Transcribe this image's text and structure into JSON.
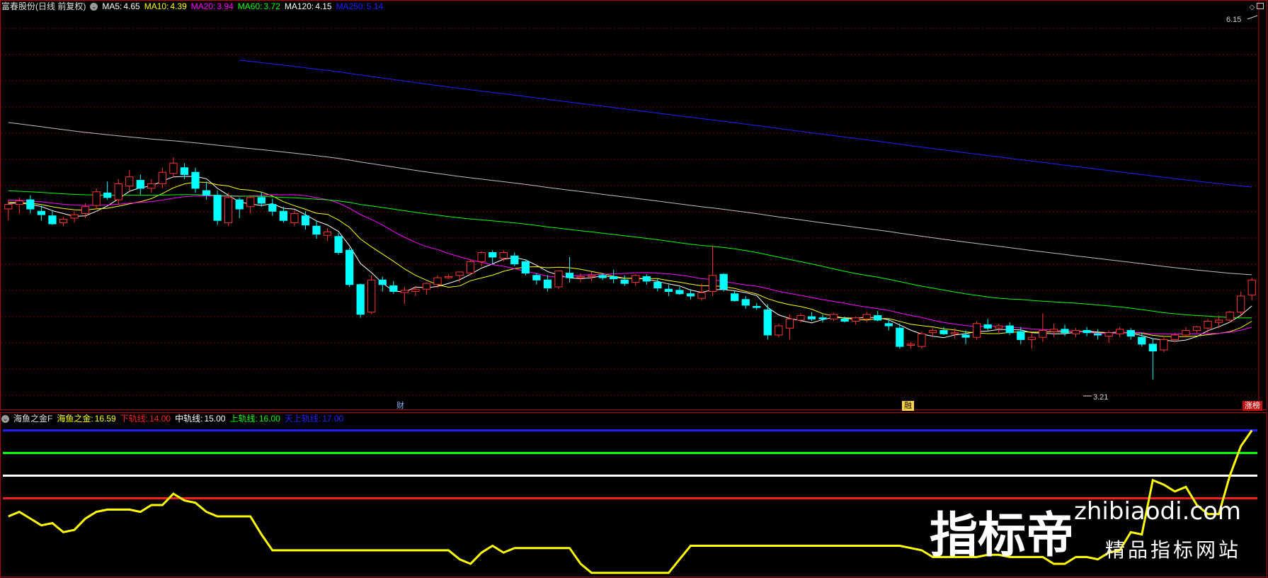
{
  "header": {
    "title": "富春股份(日线 前复权)",
    "ma": [
      {
        "label": "MA5:",
        "value": "4.65",
        "color": "#ffffff"
      },
      {
        "label": "MA10:",
        "value": "4.39",
        "color": "#ffff00"
      },
      {
        "label": "MA20:",
        "value": "3.94",
        "color": "#ff00ff"
      },
      {
        "label": "MA60:",
        "value": "3.72",
        "color": "#00ff00"
      },
      {
        "label": "MA120:",
        "value": "4.15",
        "color": "#ffffff"
      },
      {
        "label": "MA250:",
        "value": "5.14",
        "color": "#2020ff"
      }
    ]
  },
  "indicator": {
    "name": "海鱼之金F",
    "lines": [
      {
        "label": "海鱼之金:",
        "value": "16.59",
        "color": "#ffff00"
      },
      {
        "label": "下轨线:",
        "value": "14.00",
        "color": "#ff2020"
      },
      {
        "label": "中轨线:",
        "value": "15.00",
        "color": "#ffffff"
      },
      {
        "label": "上轨线:",
        "value": "16.00",
        "color": "#00ff00"
      },
      {
        "label": "天上轨线:",
        "value": "17.00",
        "color": "#2020ff"
      }
    ]
  },
  "markers": {
    "high_label": "6.15",
    "low_label": "3.21",
    "badge_cai": "财",
    "badge_rong": "融",
    "badge_zhangting": "涨榜"
  },
  "watermark": {
    "brand": "指标帝",
    "url": "zhibiaodi.com",
    "tagline": "精品指标网站"
  },
  "colors": {
    "up": "#ff3232",
    "down": "#00ffff",
    "border": "#b00000",
    "grid": "#7a0000"
  },
  "chart_data": [
    {
      "type": "candlestick",
      "title": "富春股份(日线 前复权)",
      "ylim": [
        3.0,
        6.4
      ],
      "x": [
        0,
        1,
        2,
        3,
        4,
        5,
        6,
        7,
        8,
        9,
        10,
        11,
        12,
        13,
        14,
        15,
        16,
        17,
        18,
        19,
        20,
        21,
        22,
        23,
        24,
        25,
        26,
        27,
        28,
        29,
        30,
        31,
        32,
        33,
        34,
        35,
        36,
        37,
        38,
        39,
        40,
        41,
        42,
        43,
        44,
        45,
        46,
        47,
        48,
        49,
        50,
        51,
        52,
        53,
        54,
        55,
        56,
        57,
        58,
        59,
        60,
        61,
        62,
        63,
        64,
        65,
        66,
        67,
        68,
        69,
        70,
        71,
        72,
        73,
        74,
        75,
        76,
        77,
        78,
        79,
        80,
        81,
        82,
        83,
        84,
        85,
        86,
        87,
        88,
        89,
        90,
        91,
        92,
        93,
        94,
        95,
        96,
        97,
        98,
        99,
        100,
        101,
        102,
        103,
        104,
        105,
        106,
        107,
        108,
        109,
        110,
        111,
        112,
        113
      ],
      "ohlc": [
        [
          4.7,
          4.78,
          4.6,
          4.74
        ],
        [
          4.74,
          4.8,
          4.66,
          4.77
        ],
        [
          4.78,
          4.82,
          4.66,
          4.7
        ],
        [
          4.68,
          4.73,
          4.6,
          4.65
        ],
        [
          4.64,
          4.69,
          4.56,
          4.57
        ],
        [
          4.58,
          4.63,
          4.55,
          4.61
        ],
        [
          4.62,
          4.68,
          4.58,
          4.65
        ],
        [
          4.66,
          4.75,
          4.62,
          4.72
        ],
        [
          4.73,
          4.88,
          4.7,
          4.85
        ],
        [
          4.84,
          4.94,
          4.78,
          4.8
        ],
        [
          4.78,
          4.96,
          4.74,
          4.92
        ],
        [
          4.9,
          5.04,
          4.86,
          4.98
        ],
        [
          4.95,
          5.0,
          4.82,
          4.88
        ],
        [
          4.88,
          4.96,
          4.84,
          4.92
        ],
        [
          4.92,
          5.06,
          4.88,
          5.02
        ],
        [
          5.01,
          5.15,
          4.98,
          5.1
        ],
        [
          5.06,
          5.1,
          4.96,
          5.0
        ],
        [
          5.02,
          5.06,
          4.84,
          4.88
        ],
        [
          4.86,
          4.94,
          4.78,
          4.82
        ],
        [
          4.82,
          4.86,
          4.56,
          4.6
        ],
        [
          4.58,
          4.84,
          4.55,
          4.8
        ],
        [
          4.78,
          4.8,
          4.62,
          4.7
        ],
        [
          4.72,
          4.82,
          4.66,
          4.8
        ],
        [
          4.8,
          4.85,
          4.72,
          4.75
        ],
        [
          4.74,
          4.79,
          4.64,
          4.68
        ],
        [
          4.68,
          4.72,
          4.58,
          4.6
        ],
        [
          4.58,
          4.69,
          4.55,
          4.66
        ],
        [
          4.64,
          4.68,
          4.52,
          4.56
        ],
        [
          4.55,
          4.6,
          4.44,
          4.48
        ],
        [
          4.47,
          4.53,
          4.42,
          4.5
        ],
        [
          4.46,
          4.49,
          4.3,
          4.32
        ],
        [
          4.34,
          4.36,
          4.02,
          4.04
        ],
        [
          4.04,
          4.05,
          3.75,
          3.78
        ],
        [
          3.8,
          4.12,
          3.78,
          4.08
        ],
        [
          4.08,
          4.11,
          3.98,
          4.04
        ],
        [
          4.03,
          4.07,
          3.96,
          3.98
        ],
        [
          3.97,
          4.02,
          3.87,
          3.99
        ],
        [
          3.98,
          4.03,
          3.94,
          4.0
        ],
        [
          4.0,
          4.06,
          3.95,
          4.05
        ],
        [
          4.04,
          4.12,
          4.01,
          4.1
        ],
        [
          4.1,
          4.13,
          4.09,
          4.11
        ],
        [
          4.12,
          4.15,
          4.06,
          4.15
        ],
        [
          4.14,
          4.26,
          4.12,
          4.24
        ],
        [
          4.24,
          4.33,
          4.2,
          4.32
        ],
        [
          4.32,
          4.34,
          4.22,
          4.28
        ],
        [
          4.27,
          4.34,
          4.24,
          4.32
        ],
        [
          4.29,
          4.32,
          4.2,
          4.22
        ],
        [
          4.24,
          4.26,
          4.12,
          4.14
        ],
        [
          4.12,
          4.14,
          4.04,
          4.08
        ],
        [
          4.08,
          4.12,
          3.98,
          4.01
        ],
        [
          4.02,
          4.16,
          4.0,
          4.16
        ],
        [
          4.14,
          4.28,
          4.06,
          4.1
        ],
        [
          4.1,
          4.14,
          4.06,
          4.11
        ],
        [
          4.11,
          4.15,
          4.07,
          4.12
        ],
        [
          4.12,
          4.14,
          4.08,
          4.1
        ],
        [
          4.11,
          4.17,
          4.05,
          4.09
        ],
        [
          4.08,
          4.12,
          4.03,
          4.05
        ],
        [
          4.06,
          4.13,
          4.03,
          4.12
        ],
        [
          4.11,
          4.13,
          4.04,
          4.07
        ],
        [
          4.06,
          4.09,
          3.98,
          4.01
        ],
        [
          4.0,
          4.04,
          3.94,
          3.98
        ],
        [
          3.99,
          4.02,
          3.95,
          3.96
        ],
        [
          3.96,
          4.0,
          3.91,
          3.94
        ],
        [
          3.92,
          4.05,
          3.9,
          3.97
        ],
        [
          3.98,
          4.38,
          3.94,
          4.12
        ],
        [
          4.13,
          4.14,
          3.98,
          4.0
        ],
        [
          3.96,
          3.99,
          3.89,
          3.9
        ],
        [
          3.91,
          3.94,
          3.83,
          3.86
        ],
        [
          3.85,
          3.88,
          3.82,
          3.84
        ],
        [
          3.82,
          3.87,
          3.56,
          3.6
        ],
        [
          3.6,
          3.7,
          3.58,
          3.68
        ],
        [
          3.66,
          3.78,
          3.56,
          3.74
        ],
        [
          3.73,
          3.79,
          3.71,
          3.77
        ],
        [
          3.76,
          3.8,
          3.72,
          3.74
        ],
        [
          3.75,
          3.78,
          3.71,
          3.74
        ],
        [
          3.74,
          3.79,
          3.72,
          3.78
        ],
        [
          3.74,
          3.76,
          3.71,
          3.72
        ],
        [
          3.72,
          3.76,
          3.69,
          3.75
        ],
        [
          3.74,
          3.8,
          3.71,
          3.78
        ],
        [
          3.77,
          3.81,
          3.72,
          3.73
        ],
        [
          3.7,
          3.74,
          3.64,
          3.68
        ],
        [
          3.66,
          3.7,
          3.48,
          3.5
        ],
        [
          3.51,
          3.54,
          3.48,
          3.52
        ],
        [
          3.5,
          3.63,
          3.48,
          3.61
        ],
        [
          3.62,
          3.66,
          3.58,
          3.64
        ],
        [
          3.64,
          3.67,
          3.6,
          3.61
        ],
        [
          3.61,
          3.66,
          3.57,
          3.62
        ],
        [
          3.6,
          3.64,
          3.52,
          3.58
        ],
        [
          3.58,
          3.72,
          3.56,
          3.7
        ],
        [
          3.69,
          3.74,
          3.64,
          3.66
        ],
        [
          3.66,
          3.7,
          3.62,
          3.68
        ],
        [
          3.68,
          3.71,
          3.6,
          3.62
        ],
        [
          3.63,
          3.67,
          3.52,
          3.56
        ],
        [
          3.56,
          3.62,
          3.48,
          3.58
        ],
        [
          3.58,
          3.79,
          3.54,
          3.64
        ],
        [
          3.63,
          3.7,
          3.58,
          3.65
        ],
        [
          3.65,
          3.69,
          3.59,
          3.62
        ],
        [
          3.61,
          3.66,
          3.58,
          3.64
        ],
        [
          3.64,
          3.67,
          3.59,
          3.62
        ],
        [
          3.61,
          3.65,
          3.56,
          3.6
        ],
        [
          3.59,
          3.64,
          3.53,
          3.62
        ],
        [
          3.61,
          3.67,
          3.58,
          3.65
        ],
        [
          3.64,
          3.66,
          3.56,
          3.59
        ],
        [
          3.58,
          3.62,
          3.5,
          3.52
        ],
        [
          3.52,
          3.57,
          3.21,
          3.46
        ],
        [
          3.47,
          3.58,
          3.45,
          3.56
        ],
        [
          3.56,
          3.62,
          3.54,
          3.6
        ],
        [
          3.6,
          3.67,
          3.58,
          3.64
        ],
        [
          3.64,
          3.68,
          3.62,
          3.67
        ],
        [
          3.66,
          3.74,
          3.62,
          3.72
        ],
        [
          3.71,
          3.77,
          3.66,
          3.73
        ],
        [
          3.73,
          3.81,
          3.71,
          3.8
        ],
        [
          3.8,
          3.98,
          3.76,
          3.94
        ],
        [
          3.95,
          4.1,
          3.9,
          4.08
        ]
      ],
      "series": [
        {
          "name": "MA5",
          "color": "#ffffff"
        },
        {
          "name": "MA10",
          "color": "#ffff00"
        },
        {
          "name": "MA20",
          "color": "#ff00ff"
        },
        {
          "name": "MA60",
          "color": "#00ff00"
        },
        {
          "name": "MA120",
          "color": "#ffffff"
        },
        {
          "name": "MA250",
          "color": "#2020ff"
        }
      ]
    },
    {
      "type": "line",
      "title": "海鱼之金F",
      "ylim": [
        10.6,
        17.3
      ],
      "x": [
        0,
        1,
        2,
        3,
        4,
        5,
        6,
        7,
        8,
        9,
        10,
        11,
        12,
        13,
        14,
        15,
        16,
        17,
        18,
        19,
        20,
        21,
        22,
        23,
        24,
        25,
        26,
        27,
        28,
        29,
        30,
        31,
        32,
        33,
        34,
        35,
        36,
        37,
        38,
        39,
        40,
        41,
        42,
        43,
        44,
        45,
        46,
        47,
        48,
        49,
        50,
        51,
        52,
        53,
        54,
        55,
        56,
        57,
        58,
        59,
        60,
        61,
        62,
        63,
        64,
        65,
        66,
        67,
        68,
        69,
        70,
        71,
        72,
        73,
        74,
        75,
        76,
        77,
        78,
        79,
        80,
        81,
        82,
        83,
        84,
        85,
        86,
        87,
        88,
        89,
        90,
        91,
        92,
        93,
        94,
        95,
        96,
        97,
        98,
        99,
        100,
        101,
        102,
        103,
        104,
        105,
        106,
        107,
        108,
        109,
        110,
        111,
        112,
        113
      ],
      "series": [
        {
          "name": "海鱼之金",
          "color": "#ffff00",
          "values": [
            13.2,
            13.4,
            13.1,
            12.8,
            12.9,
            12.5,
            12.6,
            13.1,
            13.4,
            13.5,
            13.5,
            13.5,
            13.4,
            13.7,
            13.7,
            14.2,
            13.9,
            13.8,
            13.4,
            13.2,
            13.2,
            13.2,
            13.2,
            12.4,
            11.7,
            11.7,
            11.7,
            11.7,
            11.7,
            11.7,
            11.7,
            11.7,
            11.7,
            11.7,
            11.7,
            11.7,
            11.7,
            11.7,
            11.7,
            11.7,
            11.7,
            11.3,
            11.1,
            11.6,
            11.9,
            11.6,
            11.8,
            11.8,
            11.8,
            11.8,
            11.8,
            11.8,
            11.1,
            10.7,
            10.7,
            10.7,
            10.7,
            10.7,
            10.7,
            10.7,
            10.7,
            11.3,
            11.9,
            11.9,
            11.9,
            11.9,
            11.9,
            11.9,
            11.9,
            11.9,
            11.9,
            11.9,
            11.9,
            11.9,
            11.9,
            11.9,
            11.9,
            11.9,
            11.9,
            11.9,
            11.9,
            11.9,
            11.8,
            11.7,
            11.4,
            11.4,
            11.4,
            11.4,
            11.4,
            11.5,
            11.5,
            11.4,
            11.4,
            11.4,
            11.4,
            11.1,
            11.1,
            11.4,
            11.4,
            11.3,
            11.6,
            11.7,
            12.5,
            12.4,
            14.8,
            14.6,
            14.3,
            14.5,
            13.7,
            13.3,
            13.3,
            15.0,
            16.3,
            17.0
          ]
        }
      ]
    }
  ]
}
